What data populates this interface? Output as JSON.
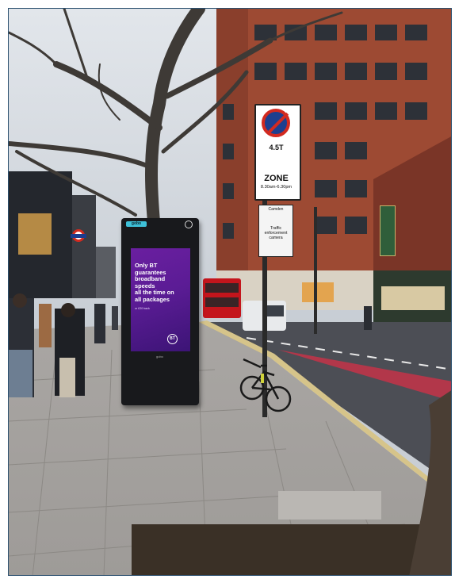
{
  "kiosk": {
    "brand": "gobo",
    "ad_lines": [
      "Only BT",
      "guarantees",
      "broadband",
      "speeds",
      "all the time on",
      "all packages"
    ],
    "ad_small": "or £20 back",
    "ad_logo": "BT",
    "base_label": "gobo"
  },
  "parking_sign": {
    "line1": "4.5T",
    "zone": "ZONE",
    "hours": "8.30am-6.30pm"
  },
  "traffic_sign": {
    "council": "Camden",
    "text": "Traffic enforcement camera"
  },
  "colors": {
    "sky": "#d3d8de",
    "pavement": "#aaa7a4",
    "road": "#4c4e55",
    "ad_purple": "#5b1c95",
    "bus_red": "#c4151c"
  }
}
